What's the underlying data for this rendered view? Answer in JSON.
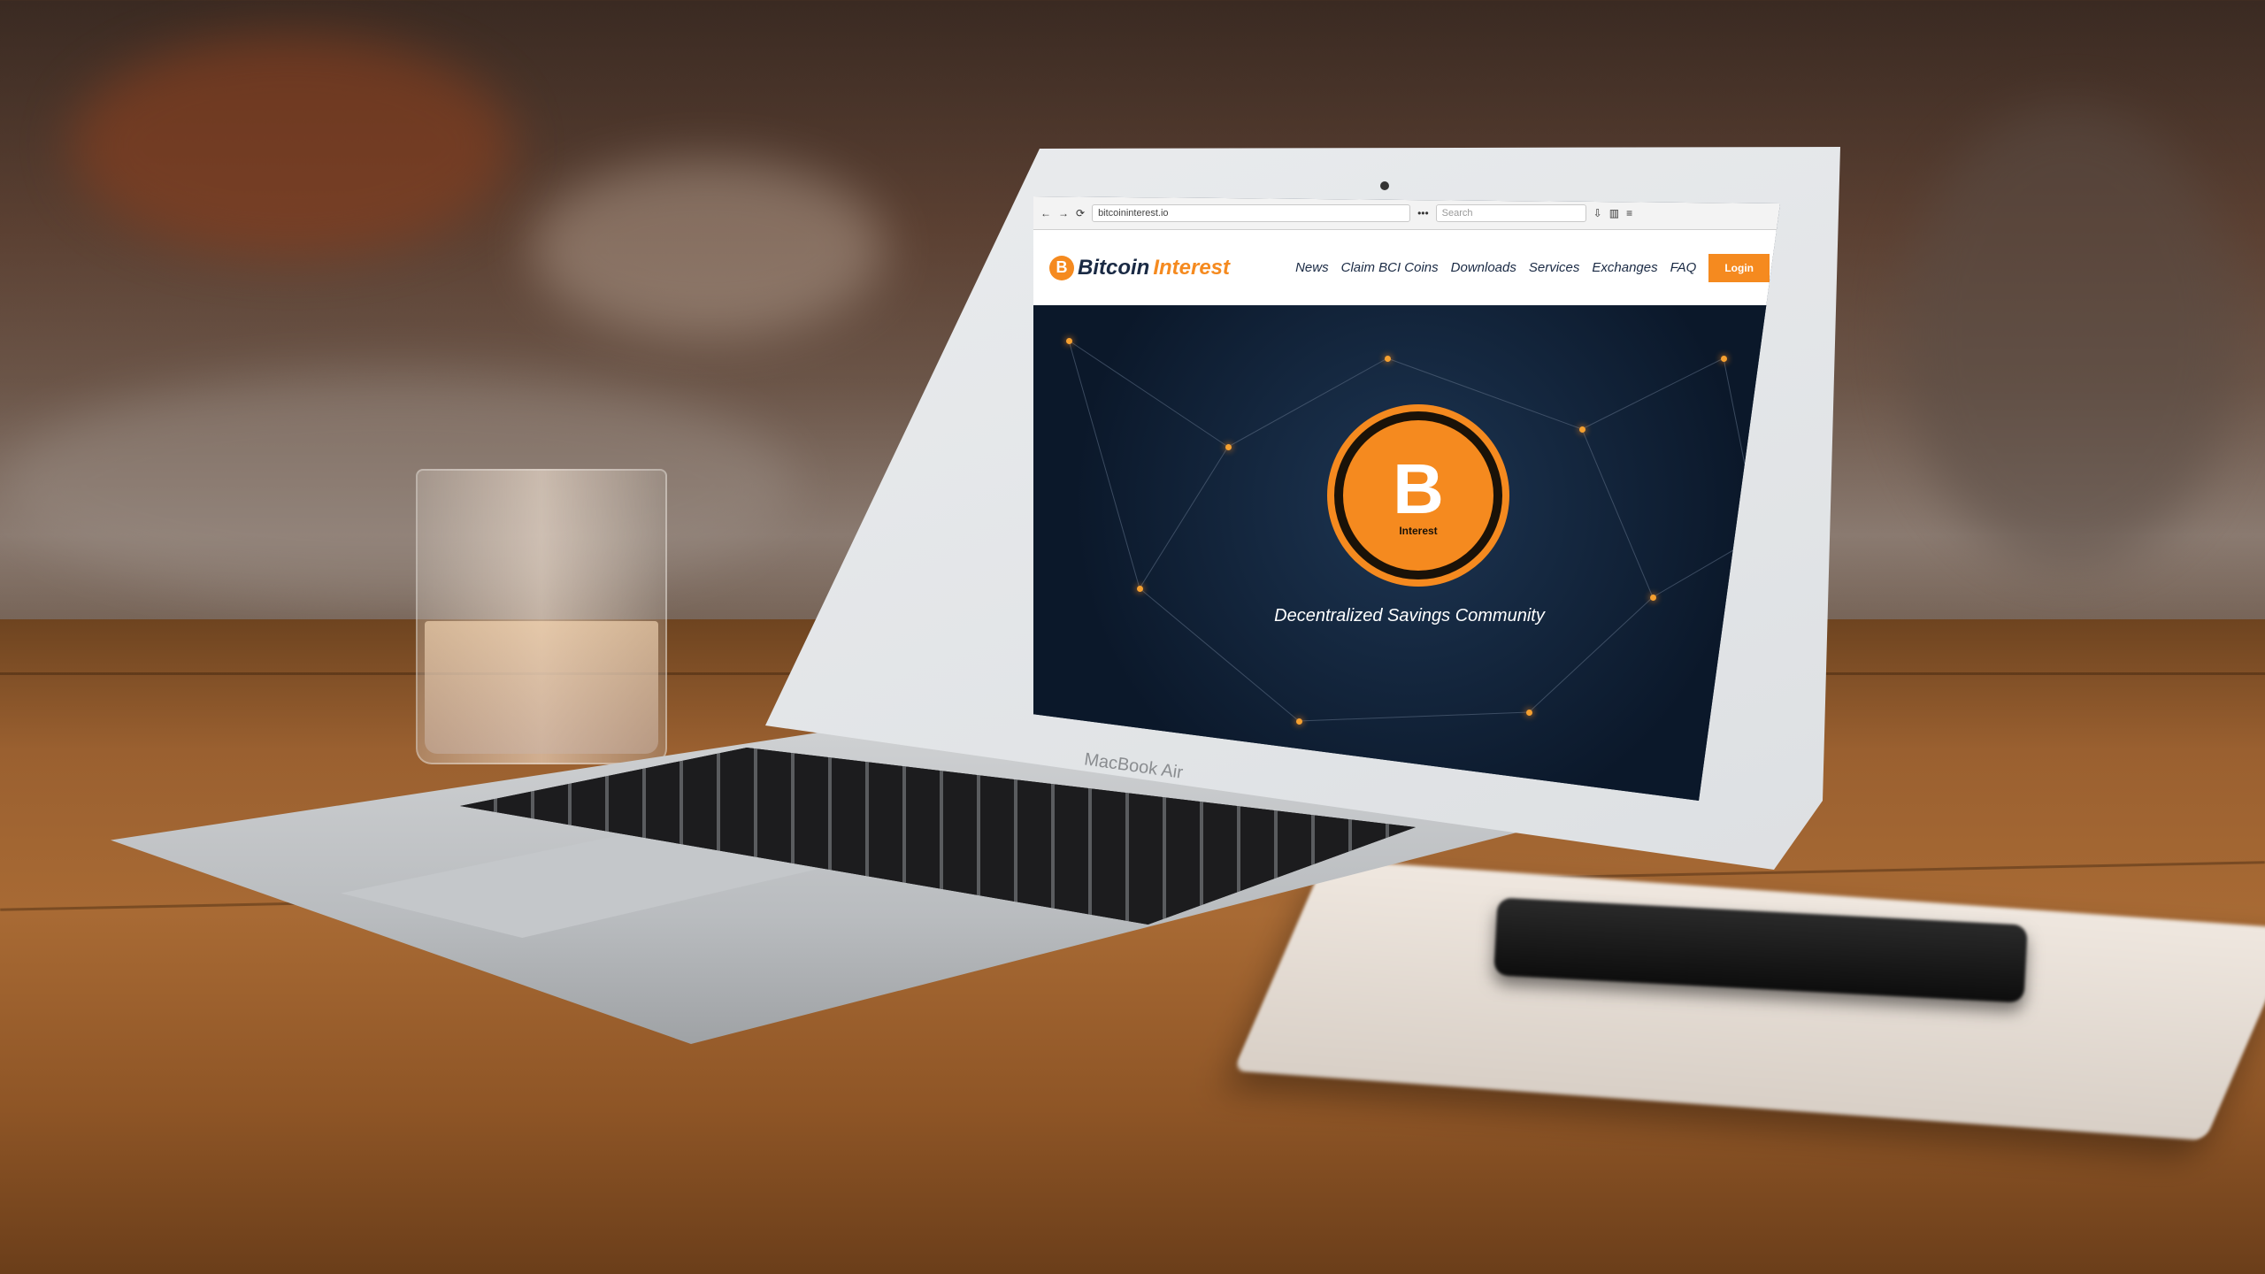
{
  "browser": {
    "back": "←",
    "forward": "→",
    "reload": "⟳",
    "url": "bitcoininterest.io",
    "more": "•••",
    "search_placeholder": "Search",
    "menu": "≡"
  },
  "site": {
    "logo_word1": "Bitcoin",
    "logo_word2": "Interest",
    "nav": [
      "News",
      "Claim BCI Coins",
      "Downloads",
      "Services",
      "Exchanges",
      "FAQ"
    ],
    "login": "Login",
    "coin_symbol": "B",
    "coin_label": "Interest",
    "tagline": "Decentralized Savings Community"
  },
  "laptop": {
    "brand": "MacBook Air"
  },
  "colors": {
    "accent": "#f58a1f",
    "hero_bg": "#0f2138",
    "text_dark": "#1a2a44"
  }
}
